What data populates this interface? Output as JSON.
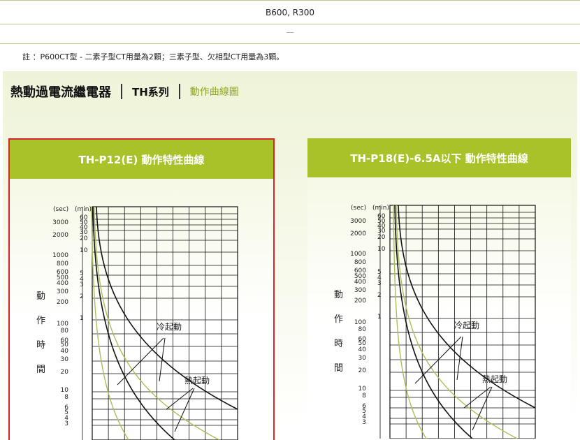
{
  "table": {
    "row1": "B600, R300",
    "row2": "—"
  },
  "note": "註 ：P600CT型 - 二素子型CT用量為2顆；三素子型、欠相型CT用量為3顆。",
  "breadcrumb": {
    "title": "熱動過電流繼電器",
    "series": "TH系列",
    "page": "動作曲線圖"
  },
  "cards": [
    {
      "title": "TH-P12(E) 動作特性曲線"
    },
    {
      "title": "TH-P18(E)-6.5A以下 動作特性曲線"
    }
  ],
  "chart_common": {
    "sec_unit": "(sec)",
    "min_unit": "(min)",
    "sec_ticks": [
      "3000",
      "2000",
      "1000",
      "800",
      "600",
      "500",
      "400",
      "300",
      "200",
      "100",
      "80",
      "60",
      "50",
      "40",
      "30",
      "20",
      "10",
      "8",
      "6",
      "5",
      "4",
      "3"
    ],
    "min_ticks": [
      "60",
      "50",
      "40",
      "30",
      "20",
      "10",
      "5",
      "4",
      "3",
      "2",
      "1"
    ],
    "ylabel": [
      "動",
      "作",
      "時",
      "間"
    ],
    "cold_start": "冷起動",
    "hot_start": "熱起動"
  },
  "colors": {
    "accent": "#aac22a",
    "highlight_border": "#d9232d",
    "curve_green": "#a9c05a"
  }
}
